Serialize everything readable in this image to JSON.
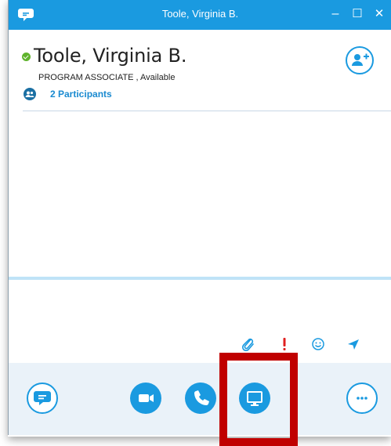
{
  "window": {
    "title": "Toole, Virginia B.",
    "minimize_label": "–",
    "maximize_label": "☐",
    "close_label": "✕"
  },
  "contact": {
    "name": "Toole, Virginia B.",
    "title": "PROGRAM ASSOCIATE",
    "status": "Available",
    "title_status": "PROGRAM ASSOCIATE , Available",
    "participants": "2 Participants"
  },
  "compose": {
    "icons": [
      "attach-icon",
      "importance-icon",
      "emoticon-icon",
      "send-icon"
    ]
  },
  "toolbar": {
    "buttons": [
      "im-button",
      "video-button",
      "call-button",
      "present-button",
      "more-options-button"
    ],
    "highlighted": "present-button"
  },
  "colors": {
    "accent": "#1a9ae0",
    "status_available": "#5fb32c",
    "highlight_frame": "#c00000",
    "importance_red": "#e02020"
  }
}
